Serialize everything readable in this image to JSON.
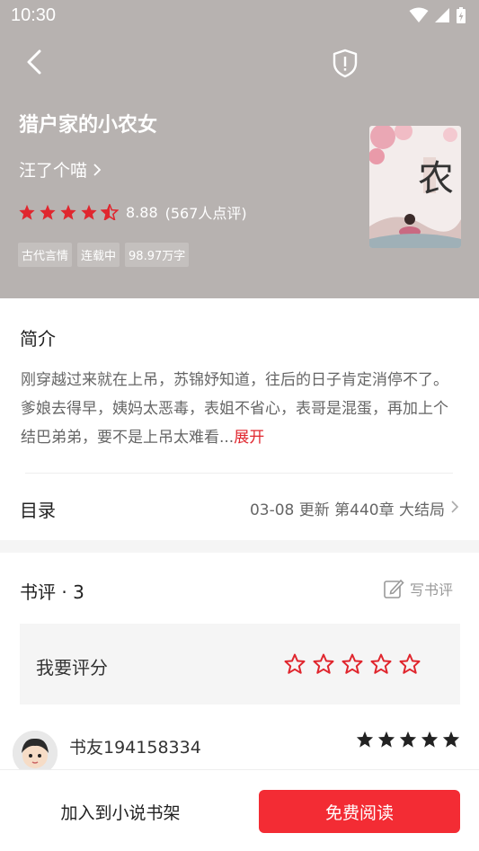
{
  "status_bar": {
    "time": "10:30"
  },
  "header": {
    "back_icon": "back-arrow-icon",
    "report_icon": "shield-alert-icon"
  },
  "book": {
    "title": "猎户家的小农女",
    "author": "汪了个喵",
    "rating_value": "8.88",
    "rating_count": "(567人点评)",
    "star_level": 4.5,
    "tags": [
      "古代言情",
      "连载中",
      "98.97万字"
    ],
    "cover_title_text": "小农女"
  },
  "intro": {
    "heading": "简介",
    "text": "刚穿越过来就在上吊，苏锦妤知道，往后的日子肯定消停不了。爹娘去得早，姨妈太恶毒，表姐不省心，表哥是混蛋，再加上个结巴弟弟，要不是上吊太难看...",
    "expand_label": "展开"
  },
  "toc": {
    "heading": "目录",
    "update_info": "03-08  更新  第440章 大结局"
  },
  "reviews": {
    "heading": "书评 · 3",
    "write_label": "写书评",
    "rate_prompt": "我要评分",
    "items": [
      {
        "username": "书友194158334",
        "stars": 5
      }
    ]
  },
  "bottom": {
    "shelf_label": "加入到小说书架",
    "read_label": "免费阅读"
  },
  "colors": {
    "accent": "#f32c34",
    "hero_bg": "#b7b2b0",
    "star_red": "#e0262e"
  }
}
